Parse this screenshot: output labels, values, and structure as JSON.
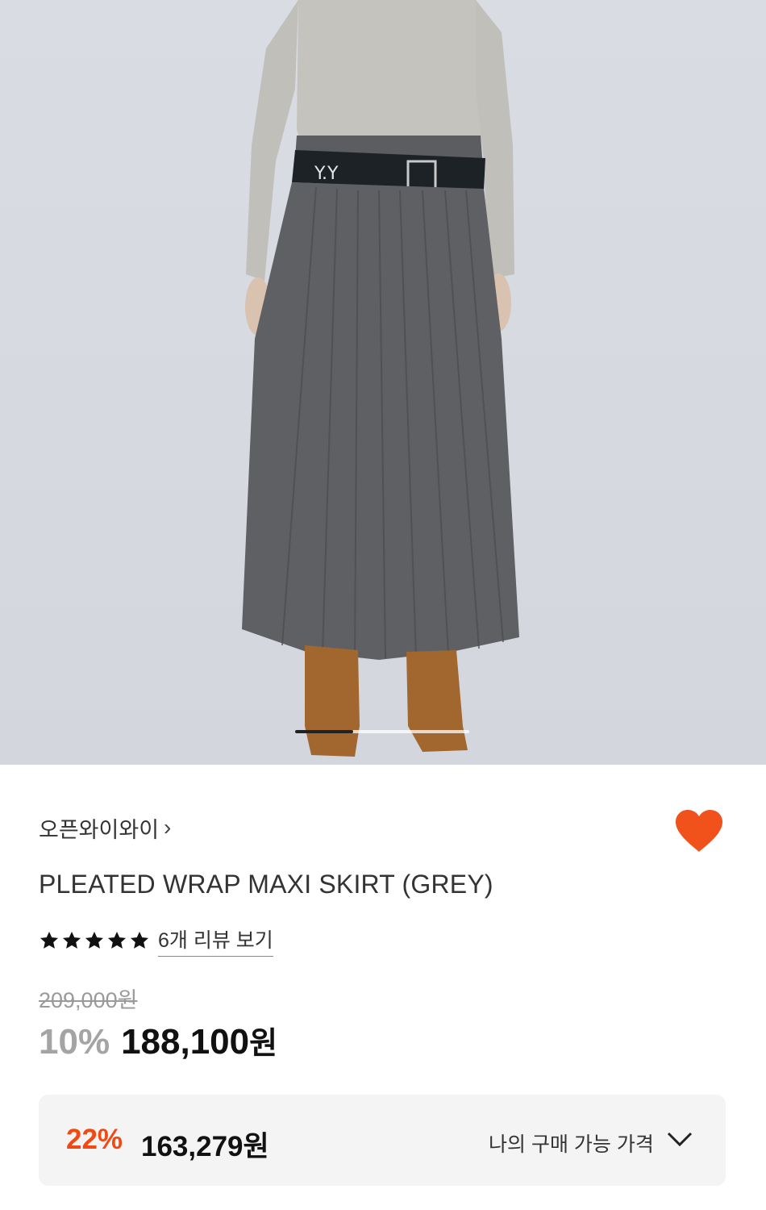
{
  "product": {
    "brand": "오픈와이와이",
    "brand_chevron": "›",
    "title": "PLEATED WRAP MAXI SKIRT (GREY)",
    "rating_stars": 5,
    "review_link": "6개 리뷰 보기",
    "original_price": "209,000원",
    "discount_rate": "10%",
    "sale_price": "188,100",
    "sale_unit": "원"
  },
  "my_price": {
    "discount_rate": "22%",
    "amount": "163,279원",
    "label": "나의 구매 가능 가격"
  },
  "carousel": {
    "total_slides": 3,
    "active_slide": 1
  },
  "colors": {
    "accent": "#f04a14",
    "heart": "#f1511b",
    "muted_discount": "#a4a4a4",
    "text": "#333333"
  },
  "icons": {
    "wishlist": "heart-icon",
    "star": "star-icon",
    "expand": "chevron-down-icon"
  }
}
